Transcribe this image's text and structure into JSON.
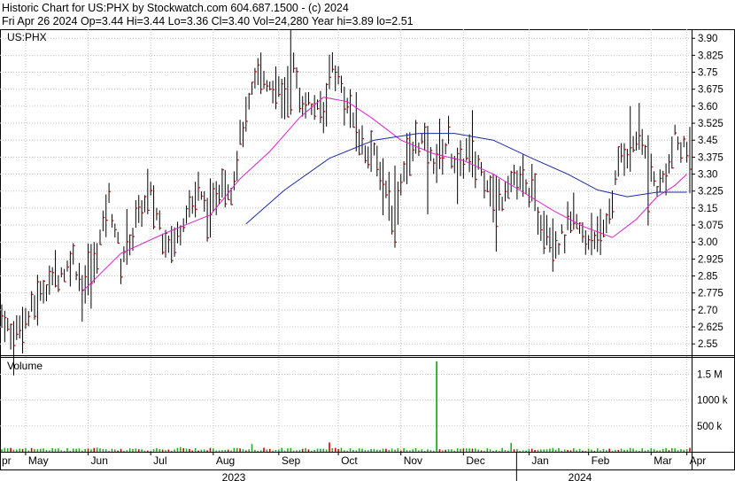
{
  "header": {
    "line1": "Historic Chart for US:PHX by Stockwatch.com 604.687.1500 - (c) 2024",
    "line2": "Fri Apr 26 2024  Op=3.44  Hi=3.44  Lo=3.36  Cl=3.40  Vol=24,280  Year hi=3.89  lo=2.51"
  },
  "colors": {
    "bar": "#000000",
    "close_tick": "#cc0000",
    "ma_short": "#dd22cc",
    "ma_long": "#1a2aa8",
    "grid": "#c0c0c0",
    "volume": "#22aa22",
    "volume_spike": "#00aa00",
    "volume_red": "#cc0000"
  },
  "chart_data": [
    {
      "type": "ohlc",
      "title": "US:PHX",
      "ylim": [
        2.5,
        3.94
      ],
      "y_ticks": [
        "3.90",
        "3.825",
        "3.75",
        "3.675",
        "3.60",
        "3.525",
        "3.45",
        "3.375",
        "3.30",
        "3.225",
        "3.15",
        "3.075",
        "3.00",
        "2.925",
        "2.85",
        "2.775",
        "2.70",
        "2.625",
        "2.55"
      ],
      "months": [
        "pr",
        "May",
        "Jun",
        "Jul",
        "Aug",
        "Sep",
        "Oct",
        "Nov",
        "Dec",
        "Jan",
        "Feb",
        "Mar",
        "Apr"
      ],
      "years": [
        "2023",
        "2024"
      ],
      "price_path": [
        [
          0,
          2.68
        ],
        [
          4,
          2.58
        ],
        [
          8,
          2.64
        ],
        [
          12,
          2.76
        ],
        [
          16,
          2.82
        ],
        [
          20,
          2.86
        ],
        [
          24,
          2.92
        ],
        [
          27,
          2.8
        ],
        [
          30,
          2.86
        ],
        [
          34,
          3.05
        ],
        [
          36,
          3.2
        ],
        [
          40,
          2.92
        ],
        [
          44,
          3.05
        ],
        [
          47,
          3.15
        ],
        [
          50,
          3.2
        ],
        [
          54,
          3.05
        ],
        [
          58,
          2.98
        ],
        [
          62,
          3.15
        ],
        [
          66,
          3.2
        ],
        [
          70,
          3.12
        ],
        [
          74,
          3.3
        ],
        [
          77,
          3.22
        ],
        [
          80,
          3.45
        ],
        [
          83,
          3.6
        ],
        [
          86,
          3.75
        ],
        [
          90,
          3.7
        ],
        [
          94,
          3.62
        ],
        [
          98,
          3.75
        ],
        [
          100,
          3.65
        ],
        [
          104,
          3.6
        ],
        [
          108,
          3.55
        ],
        [
          111,
          3.78
        ],
        [
          114,
          3.7
        ],
        [
          117,
          3.55
        ],
        [
          120,
          3.45
        ],
        [
          123,
          3.4
        ],
        [
          126,
          3.35
        ],
        [
          129,
          3.25
        ],
        [
          132,
          3.1
        ],
        [
          135,
          3.35
        ],
        [
          138,
          3.4
        ],
        [
          141,
          3.45
        ],
        [
          144,
          3.35
        ],
        [
          147,
          3.4
        ],
        [
          150,
          3.45
        ],
        [
          153,
          3.3
        ],
        [
          156,
          3.4
        ],
        [
          160,
          3.35
        ],
        [
          163,
          3.28
        ],
        [
          166,
          3.15
        ],
        [
          169,
          3.25
        ],
        [
          172,
          3.3
        ],
        [
          175,
          3.25
        ],
        [
          178,
          3.22
        ],
        [
          181,
          3.1
        ],
        [
          184,
          3.02
        ],
        [
          187,
          3.0
        ],
        [
          190,
          3.05
        ],
        [
          193,
          3.08
        ],
        [
          196,
          3.0
        ],
        [
          199,
          3.05
        ],
        [
          202,
          3.04
        ],
        [
          205,
          3.2
        ],
        [
          208,
          3.38
        ],
        [
          211,
          3.42
        ],
        [
          214,
          3.48
        ],
        [
          217,
          3.35
        ],
        [
          220,
          3.25
        ],
        [
          223,
          3.28
        ],
        [
          226,
          3.45
        ],
        [
          229,
          3.42
        ]
      ],
      "ma_short": [
        [
          27,
          2.78
        ],
        [
          40,
          2.95
        ],
        [
          55,
          3.04
        ],
        [
          70,
          3.12
        ],
        [
          80,
          3.28
        ],
        [
          90,
          3.4
        ],
        [
          100,
          3.55
        ],
        [
          108,
          3.64
        ],
        [
          116,
          3.62
        ],
        [
          124,
          3.55
        ],
        [
          134,
          3.45
        ],
        [
          145,
          3.39
        ],
        [
          155,
          3.36
        ],
        [
          165,
          3.3
        ],
        [
          175,
          3.22
        ],
        [
          185,
          3.14
        ],
        [
          195,
          3.07
        ],
        [
          205,
          3.02
        ],
        [
          213,
          3.1
        ],
        [
          220,
          3.2
        ],
        [
          226,
          3.25
        ],
        [
          230,
          3.3
        ]
      ],
      "ma_long": [
        [
          82,
          3.08
        ],
        [
          95,
          3.23
        ],
        [
          110,
          3.37
        ],
        [
          125,
          3.45
        ],
        [
          140,
          3.48
        ],
        [
          152,
          3.48
        ],
        [
          165,
          3.45
        ],
        [
          178,
          3.37
        ],
        [
          190,
          3.3
        ],
        [
          200,
          3.23
        ],
        [
          210,
          3.2
        ],
        [
          220,
          3.22
        ],
        [
          230,
          3.22
        ]
      ]
    },
    {
      "type": "bar",
      "title": "Volume",
      "ylim": [
        0,
        1800000
      ],
      "y_ticks": [
        "1.5 M",
        "1000 k",
        "500 k"
      ],
      "base_volume": 60000,
      "spikes": [
        [
          146,
          1750000
        ],
        [
          110,
          180000
        ],
        [
          84,
          150000
        ],
        [
          171,
          170000
        ],
        [
          60,
          90000
        ],
        [
          32,
          80000
        ]
      ]
    }
  ]
}
